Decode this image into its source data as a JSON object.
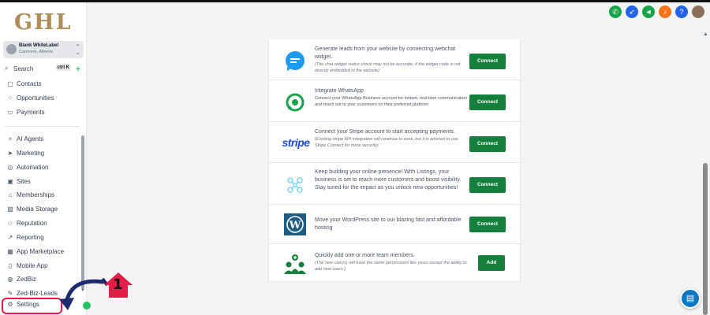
{
  "logo": "GHL",
  "account": {
    "name": "Blank WhiteLabel",
    "location": "Canmore, Alberta"
  },
  "search": {
    "label": "Search",
    "shortcut": "ctrl K"
  },
  "nav": {
    "group1": [
      {
        "label": "Contacts",
        "icon": "contacts-icon"
      },
      {
        "label": "Opportunities",
        "icon": "opportunities-icon"
      },
      {
        "label": "Payments",
        "icon": "payments-icon"
      }
    ],
    "group2": [
      {
        "label": "AI Agents",
        "icon": "ai-agents-icon"
      },
      {
        "label": "Marketing",
        "icon": "marketing-icon"
      },
      {
        "label": "Automation",
        "icon": "automation-icon"
      },
      {
        "label": "Sites",
        "icon": "sites-icon"
      },
      {
        "label": "Memberships",
        "icon": "memberships-icon"
      },
      {
        "label": "Media Storage",
        "icon": "media-storage-icon"
      },
      {
        "label": "Reputation",
        "icon": "reputation-icon"
      },
      {
        "label": "Reporting",
        "icon": "reporting-icon"
      },
      {
        "label": "App Marketplace",
        "icon": "app-marketplace-icon"
      },
      {
        "label": "Mobile App",
        "icon": "mobile-app-icon"
      },
      {
        "label": "ZedBiz",
        "icon": "zedbiz-icon"
      },
      {
        "label": "Zed-Biz-Leads",
        "icon": "zed-biz-leads-icon"
      }
    ],
    "settings": {
      "label": "Settings",
      "icon": "gear-icon"
    }
  },
  "annotation": {
    "step": "1"
  },
  "header_icons": [
    {
      "name": "phone-icon",
      "color": "#16a34a"
    },
    {
      "name": "rocket-icon",
      "color": "#2563eb"
    },
    {
      "name": "megaphone-icon",
      "color": "#16a34a"
    },
    {
      "name": "bell-icon",
      "color": "#f97316"
    },
    {
      "name": "help-icon",
      "color": "#2563eb"
    }
  ],
  "help_glyph": "?",
  "integrations": [
    {
      "icon": "webchat-icon",
      "text": "Generate leads from your website by connecting webchat widget.",
      "note": "(The chat widget status check may not be accurate, if the widget code is not directly embedded in the website)",
      "button": "Connect"
    },
    {
      "icon": "whatsapp-icon",
      "text": "Integrate WhatsApp",
      "text2": "Connect your WhatsApp Business account for instant, real-time communication and reach out to your customers on their preferred platform",
      "button": "Connect"
    },
    {
      "icon": "stripe-logo",
      "logo_text": "stripe",
      "text": "Connect your Stripe account to start accepting payments.",
      "note": "(Existing stripe API integration will continue to work, but it is advised to use Stripe Connect for more security)",
      "button": "Connect"
    },
    {
      "icon": "listings-icon",
      "text": "Keep building your online presence! With Listings, your business is set to reach more customers and boost visibility. Stay tuned for the impact as you unlock new opportunities!",
      "button": "Connect"
    },
    {
      "icon": "wordpress-icon",
      "text": "Move your WordPress site to our blazing fast and affordable hosting",
      "button": "Connect"
    },
    {
      "icon": "team-members-icon",
      "text": "Quickly add one or more team members.",
      "note": "(The new user(s) will have the same permissions like yours except the ability to add new users.)",
      "button": "Add"
    }
  ],
  "colors": {
    "accent_green": "#15803d",
    "logo_gold": "#b08d57",
    "annotation_red": "#e11d48",
    "arrow_navy": "#1e2a6e"
  }
}
